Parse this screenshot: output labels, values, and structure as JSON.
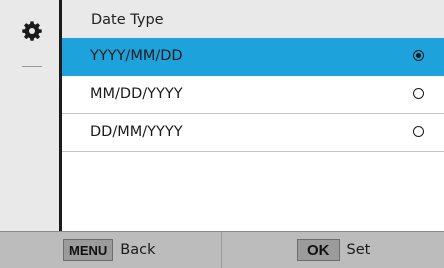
{
  "sidebar": {
    "icon": "gear-icon"
  },
  "header": {
    "title": "Date Type"
  },
  "options": [
    {
      "label": "YYYY/MM/DD",
      "selected": true
    },
    {
      "label": "MM/DD/YYYY",
      "selected": false
    },
    {
      "label": "DD/MM/YYYY",
      "selected": false
    }
  ],
  "footer": {
    "back_key": "MENU",
    "back_label": "Back",
    "set_key": "OK",
    "set_label": "Set"
  },
  "colors": {
    "selection": "#1ea2dc",
    "panel": "#e9e9e9",
    "footer": "#bcbcbc"
  }
}
